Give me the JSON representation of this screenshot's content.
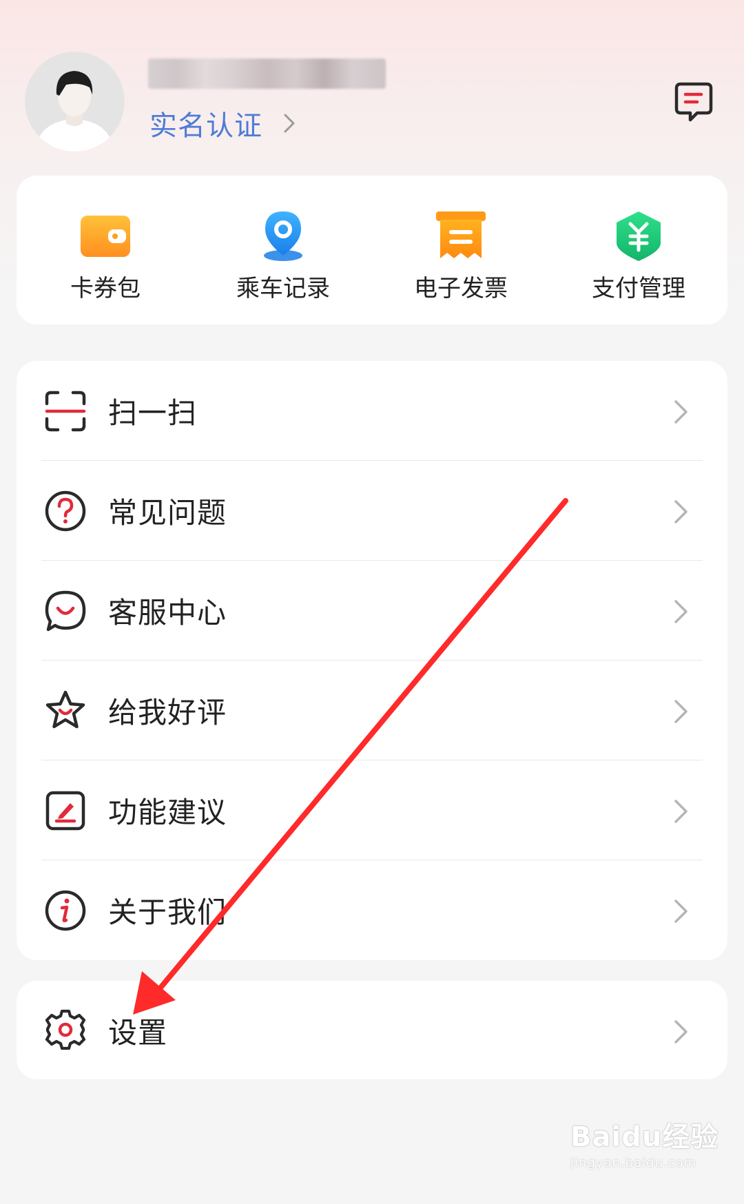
{
  "header": {
    "real_name_link": "实名认证"
  },
  "quick_actions": [
    {
      "label": "卡券包",
      "icon": "wallet-icon"
    },
    {
      "label": "乘车记录",
      "icon": "location-pin-icon"
    },
    {
      "label": "电子发票",
      "icon": "invoice-icon"
    },
    {
      "label": "支付管理",
      "icon": "yuan-shield-icon"
    }
  ],
  "menu": [
    {
      "label": "扫一扫",
      "icon": "scan-icon"
    },
    {
      "label": "常见问题",
      "icon": "question-icon"
    },
    {
      "label": "客服中心",
      "icon": "customer-service-icon"
    },
    {
      "label": "给我好评",
      "icon": "star-icon"
    },
    {
      "label": "功能建议",
      "icon": "feedback-edit-icon"
    },
    {
      "label": "关于我们",
      "icon": "info-icon"
    }
  ],
  "settings": {
    "label": "设置",
    "icon": "gear-icon"
  },
  "watermark": {
    "brand": "Baidu经验",
    "url": "jingyan.baidu.com"
  },
  "colors": {
    "accent_blue": "#4e7bd6",
    "brand_red": "#e02b3b",
    "annotation_arrow": "#ff2a2a",
    "orange": "#ff9f1a",
    "blue": "#2a9bf5",
    "green": "#1ec97a"
  }
}
